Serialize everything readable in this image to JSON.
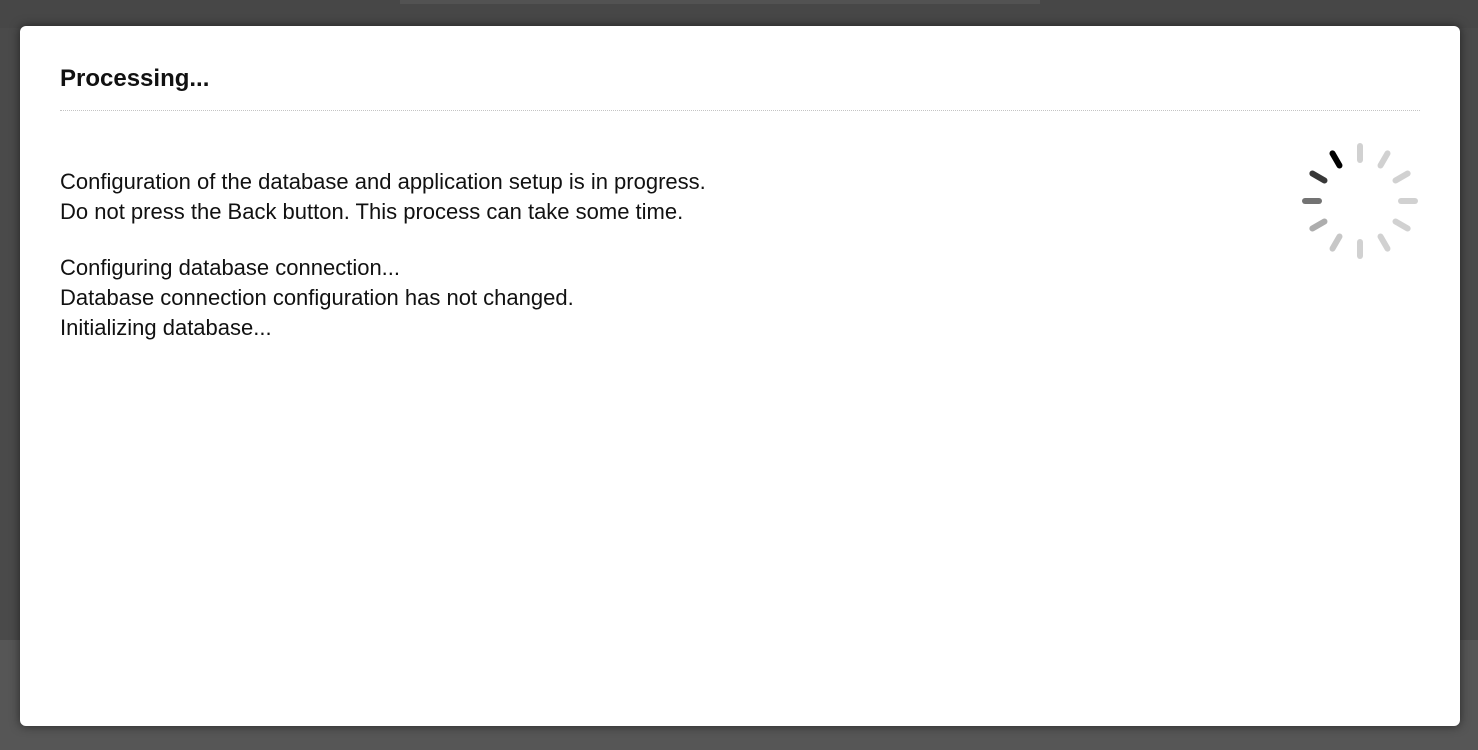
{
  "dialog": {
    "title": "Processing...",
    "message_lines": [
      "Configuration of the database and application setup is in progress.",
      "Do not press the Back button. This process can take some time."
    ],
    "log_lines": [
      "Configuring database connection...",
      "Database connection configuration has not changed.",
      "Initializing database..."
    ],
    "spinner_icon": "loading-spinner-icon"
  },
  "colors": {
    "backdrop": "#4a4a4a",
    "dialog_background": "#ffffff",
    "text": "#111111",
    "divider": "#c4c4c4",
    "spinner": "#000000"
  }
}
